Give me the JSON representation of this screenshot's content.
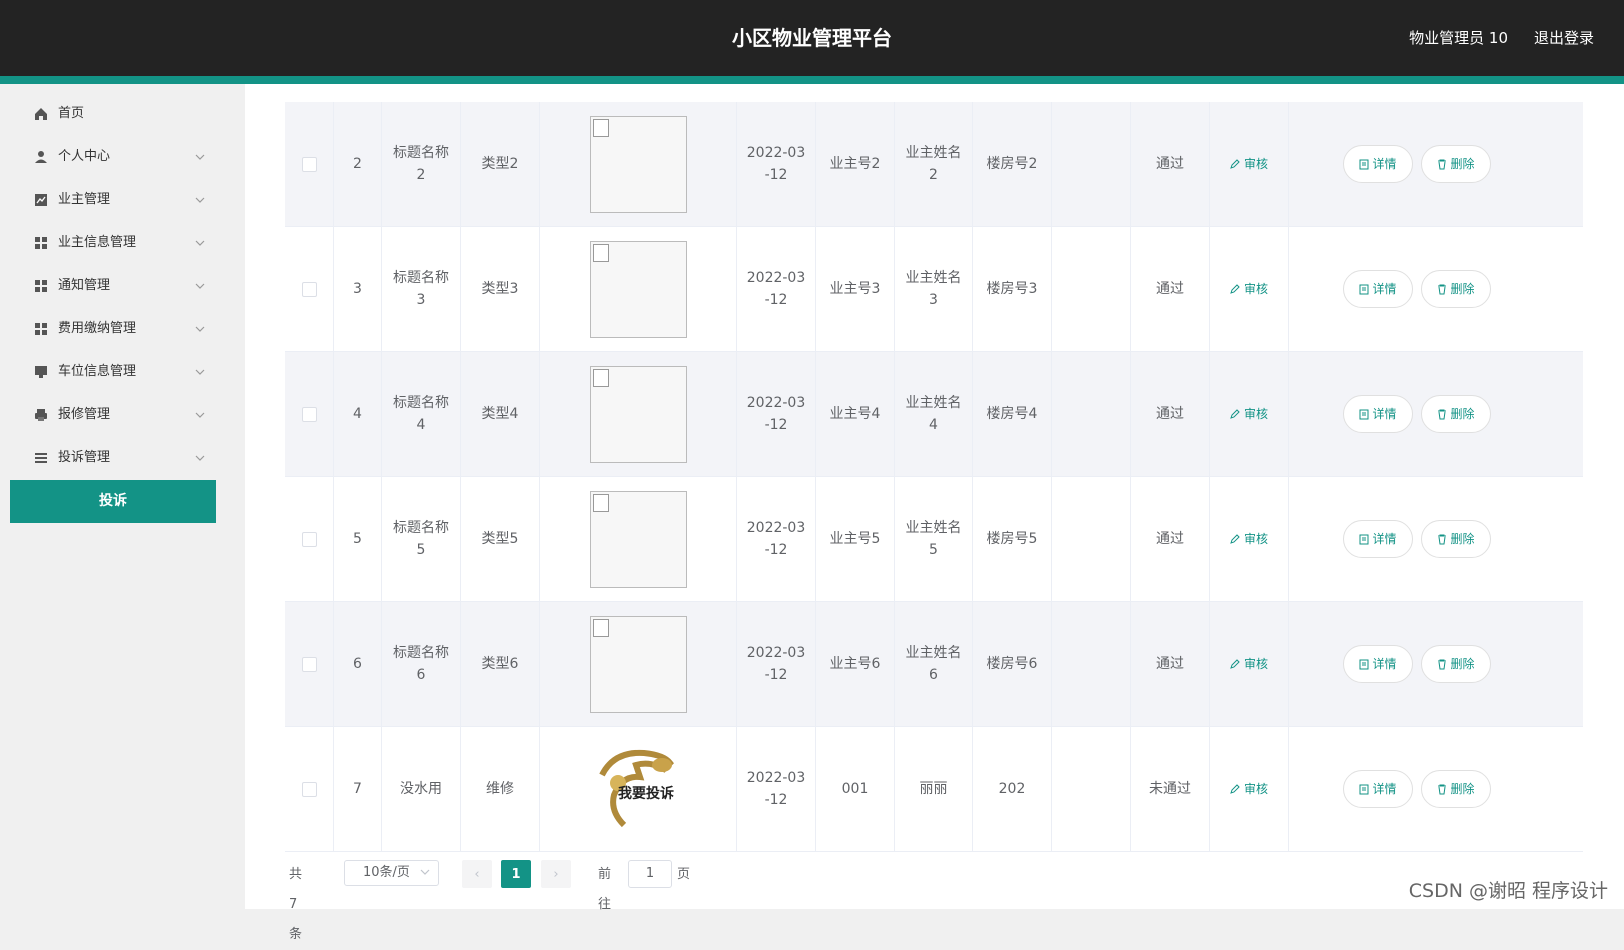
{
  "header": {
    "title": "小区物业管理平台",
    "user": "物业管理员 10",
    "logout": "退出登录"
  },
  "sidebar": {
    "items": [
      {
        "label": "首页",
        "icon": "home-icon",
        "expandable": false
      },
      {
        "label": "个人中心",
        "icon": "user-icon",
        "expandable": true
      },
      {
        "label": "业主管理",
        "icon": "chart-icon",
        "expandable": true
      },
      {
        "label": "业主信息管理",
        "icon": "grid-icon",
        "expandable": true
      },
      {
        "label": "通知管理",
        "icon": "grid-icon",
        "expandable": true
      },
      {
        "label": "费用缴纳管理",
        "icon": "grid-icon",
        "expandable": true
      },
      {
        "label": "车位信息管理",
        "icon": "monitor-icon",
        "expandable": true
      },
      {
        "label": "报修管理",
        "icon": "printer-icon",
        "expandable": true
      },
      {
        "label": "投诉管理",
        "icon": "list-icon",
        "expandable": true
      }
    ],
    "active_sub": "投诉"
  },
  "table": {
    "audit_label": "审核",
    "detail_label": "详情",
    "delete_label": "删除",
    "rows": [
      {
        "index": "2",
        "title": "标题名称\n2",
        "type": "类型2",
        "date": "2022-03\n-12",
        "owner_no": "业主号2",
        "owner_name": "业主姓名\n2",
        "room": "楼房号2",
        "status": "通过",
        "image": "broken"
      },
      {
        "index": "3",
        "title": "标题名称\n3",
        "type": "类型3",
        "date": "2022-03\n-12",
        "owner_no": "业主号3",
        "owner_name": "业主姓名\n3",
        "room": "楼房号3",
        "status": "通过",
        "image": "broken"
      },
      {
        "index": "4",
        "title": "标题名称\n4",
        "type": "类型4",
        "date": "2022-03\n-12",
        "owner_no": "业主号4",
        "owner_name": "业主姓名\n4",
        "room": "楼房号4",
        "status": "通过",
        "image": "broken"
      },
      {
        "index": "5",
        "title": "标题名称\n5",
        "type": "类型5",
        "date": "2022-03\n-12",
        "owner_no": "业主号5",
        "owner_name": "业主姓名\n5",
        "room": "楼房号5",
        "status": "通过",
        "image": "broken"
      },
      {
        "index": "6",
        "title": "标题名称\n6",
        "type": "类型6",
        "date": "2022-03\n-12",
        "owner_no": "业主号6",
        "owner_name": "业主姓名\n6",
        "room": "楼房号6",
        "status": "通过",
        "image": "broken"
      },
      {
        "index": "7",
        "title": "没水用",
        "type": "维修",
        "date": "2022-03\n-12",
        "owner_no": "001",
        "owner_name": "丽丽",
        "room": "202",
        "status": "未通过",
        "image": "complaint",
        "image_text": "我要投诉"
      }
    ]
  },
  "pagination": {
    "total": "共 7 条",
    "page_size": "10条/页",
    "current": "1",
    "goto": "前往",
    "goto_value": "1",
    "page": "页"
  },
  "watermark": "CSDN @谢昭  程序设计",
  "colors": {
    "accent": "#139386",
    "header_bg": "#232323"
  }
}
